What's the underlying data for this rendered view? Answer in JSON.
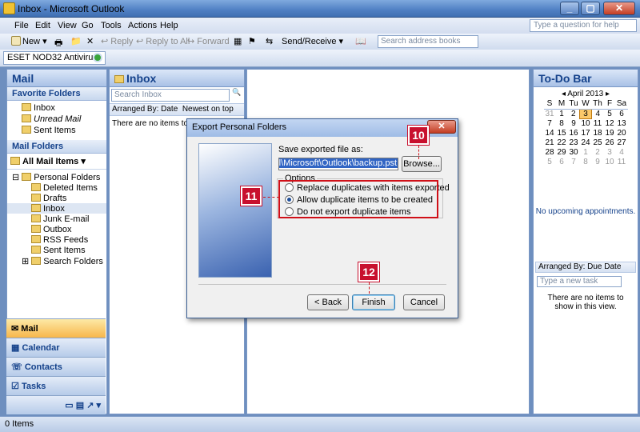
{
  "window": {
    "title": "Inbox - Microsoft Outlook"
  },
  "menu": [
    "File",
    "Edit",
    "View",
    "Go",
    "Tools",
    "Actions",
    "Help"
  ],
  "ask_placeholder": "Type a question for help",
  "toolbar": {
    "new": "New",
    "reply": "Reply",
    "reply_all": "Reply to All",
    "forward": "Forward",
    "send_receive": "Send/Receive",
    "address_search": "Search address books"
  },
  "eset": "ESET NOD32 Antivirus",
  "nav": {
    "title": "Mail",
    "favorites_header": "Favorite Folders",
    "favorites": [
      "Inbox",
      "Unread Mail",
      "Sent Items"
    ],
    "mail_folders_header": "Mail Folders",
    "all_mail_items": "All Mail Items",
    "personal_folders": "Personal Folders",
    "folders": [
      "Deleted Items",
      "Drafts",
      "Inbox",
      "Junk E-mail",
      "Outbox",
      "RSS Feeds",
      "Sent Items",
      "Search Folders"
    ],
    "buttons": [
      "Mail",
      "Calendar",
      "Contacts",
      "Tasks"
    ]
  },
  "inbox": {
    "title": "Inbox",
    "search_placeholder": "Search Inbox",
    "arranged_by": "Arranged By: Date",
    "sort": "Newest on top",
    "empty": "There are no items to show in this view."
  },
  "todo": {
    "title": "To-Do Bar",
    "month": "April 2013",
    "weekdays": [
      "S",
      "M",
      "Tu",
      "W",
      "Th",
      "F",
      "Sa"
    ],
    "weeks": [
      [
        "31",
        "1",
        "2",
        "3",
        "4",
        "5",
        "6"
      ],
      [
        "7",
        "8",
        "9",
        "10",
        "11",
        "12",
        "13"
      ],
      [
        "14",
        "15",
        "16",
        "17",
        "18",
        "19",
        "20"
      ],
      [
        "21",
        "22",
        "23",
        "24",
        "25",
        "26",
        "27"
      ],
      [
        "28",
        "29",
        "30",
        "1",
        "2",
        "3",
        "4"
      ],
      [
        "5",
        "6",
        "7",
        "8",
        "9",
        "10",
        "11"
      ]
    ],
    "today": "3",
    "no_appointments": "No upcoming appointments.",
    "arranged_by": "Arranged By: Due Date",
    "task_placeholder": "Type a new task",
    "empty": "There are no items to show in this view."
  },
  "dialog": {
    "title": "Export Personal Folders",
    "save_label": "Save exported file as:",
    "file_path": "Data\\Local\\Microsoft\\Outlook\\backup.pst",
    "browse": "Browse...",
    "options_label": "Options",
    "options": [
      "Replace duplicates with items exported",
      "Allow duplicate items to be created",
      "Do not export duplicate items"
    ],
    "selected_option": 1,
    "back": "< Back",
    "finish": "Finish",
    "cancel": "Cancel"
  },
  "callouts": [
    "10",
    "11",
    "12"
  ],
  "status": "0 Items",
  "colors": {
    "accent": "#15428b",
    "callout": "#c8102e",
    "selected_nav": "#f7b64a"
  }
}
